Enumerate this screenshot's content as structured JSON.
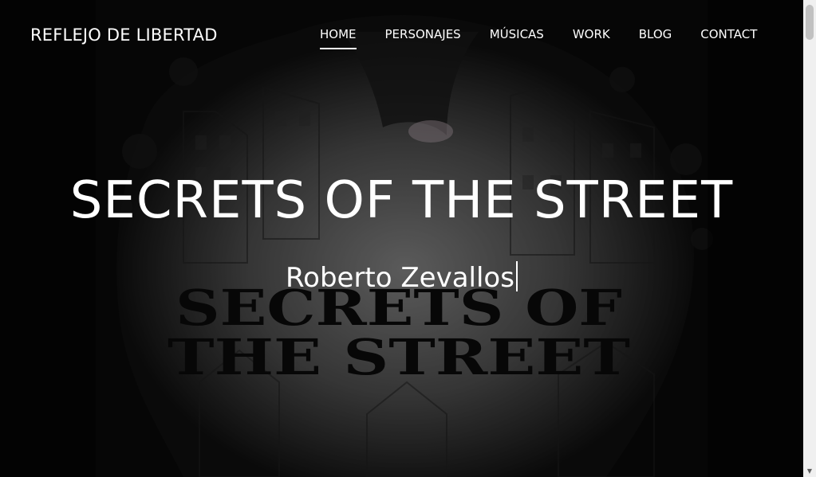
{
  "navbar": {
    "brand": "REFLEJO DE LIBERTAD",
    "items": [
      {
        "label": "HOME",
        "active": true
      },
      {
        "label": "PERSONAJES",
        "active": false
      },
      {
        "label": "MÚSICAS",
        "active": false
      },
      {
        "label": "WORK",
        "active": false
      },
      {
        "label": "BLOG",
        "active": false
      },
      {
        "label": "CONTACT",
        "active": false
      }
    ]
  },
  "hero": {
    "title": "SECRETS OF THE STREET",
    "subtitle": "Roberto Zevallos",
    "background_image_text": "SECRETS OF THE STREET",
    "background_image_line1": "SECRETS OF",
    "background_image_line2": "THE STREET"
  },
  "colors": {
    "text": "#ffffff",
    "background": "#000000",
    "scrollbar_track": "#f0f0f0",
    "scrollbar_thumb": "#c1c1c1"
  }
}
